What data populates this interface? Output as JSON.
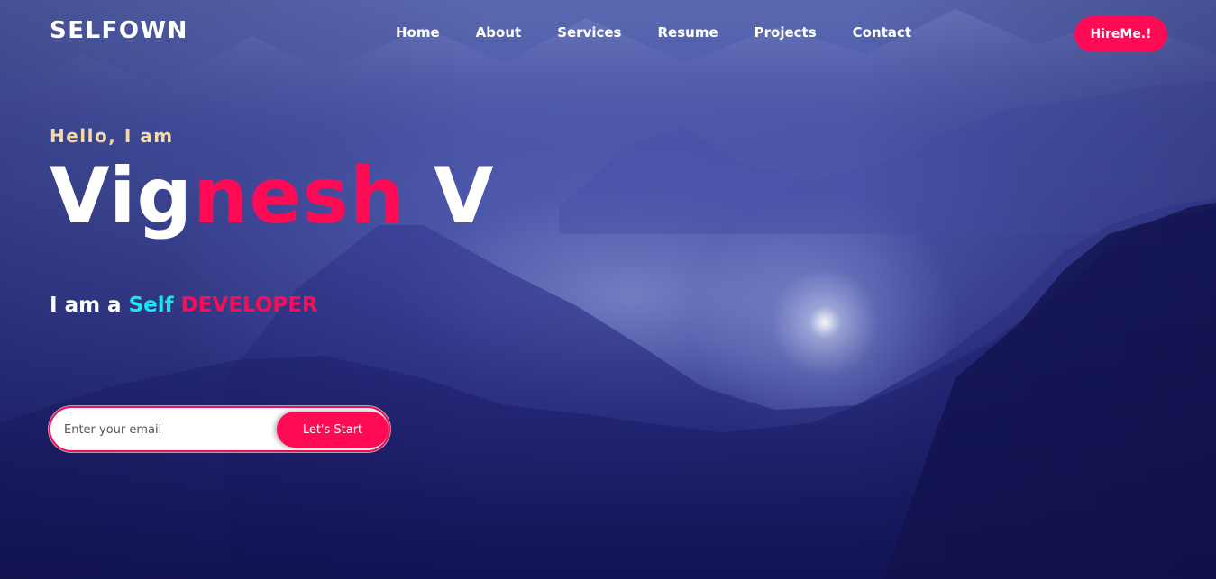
{
  "header": {
    "logo": "SELFOWN",
    "nav": [
      "Home",
      "About",
      "Services",
      "Resume",
      "Projects",
      "Contact"
    ],
    "hire_label": "HireMe.!"
  },
  "hero": {
    "greeting": "Hello, I am",
    "name_first": "Vig",
    "name_accent": "nesh",
    "name_last": " V",
    "tagline_prefix": "I am a ",
    "tagline_self": "Self",
    "tagline_role": " DEVELOPER"
  },
  "signup": {
    "email_placeholder": "Enter your email",
    "email_value": "",
    "button_label": "Let's Start"
  },
  "colors": {
    "accent": "#ff0a54",
    "cyan": "#1ee3f0",
    "greeting": "#f2d9a8"
  }
}
